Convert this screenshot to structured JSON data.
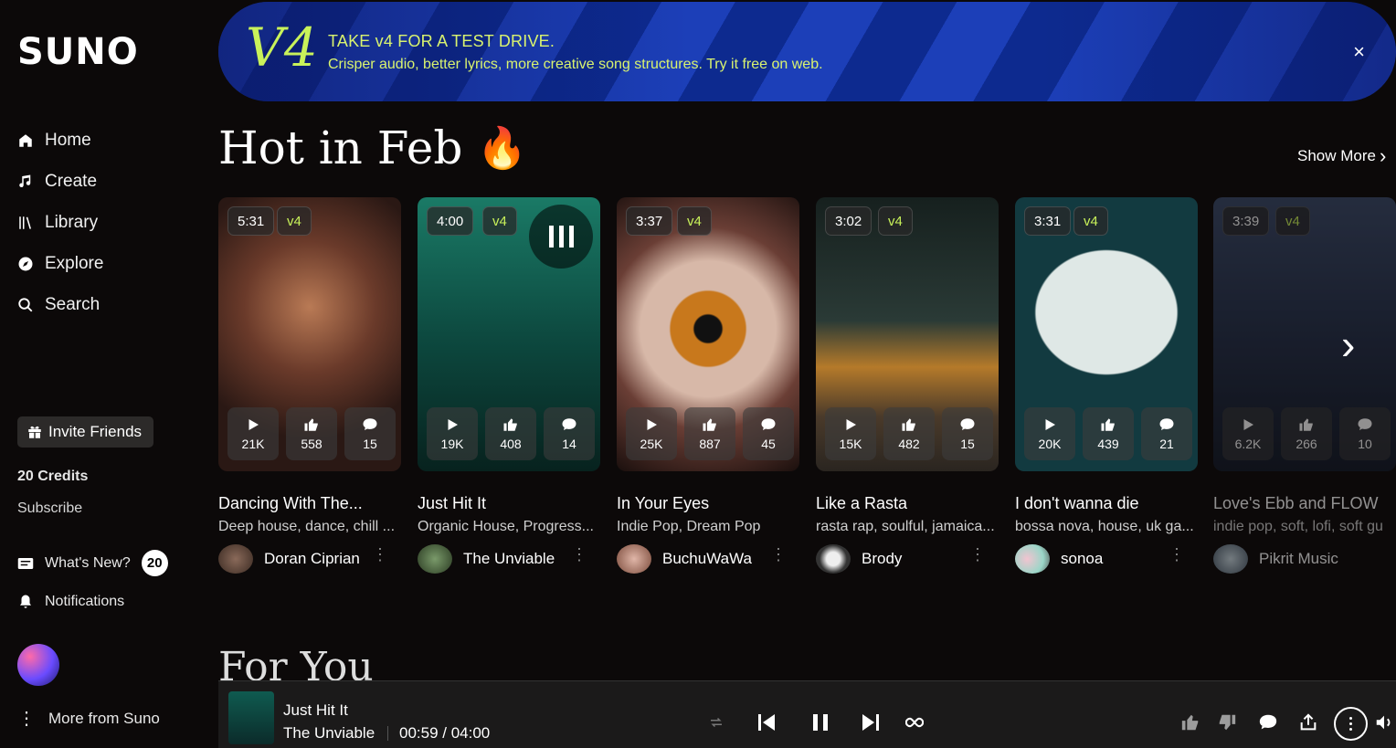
{
  "sidebar": {
    "logo": "SUNO",
    "nav": [
      {
        "label": "Home",
        "icon": "home-icon"
      },
      {
        "label": "Create",
        "icon": "music-note-icon"
      },
      {
        "label": "Library",
        "icon": "library-icon"
      },
      {
        "label": "Explore",
        "icon": "compass-icon"
      },
      {
        "label": "Search",
        "icon": "search-icon"
      }
    ],
    "invite_label": "Invite Friends",
    "credits": "20 Credits",
    "subscribe": "Subscribe",
    "whats_new": "What's New?",
    "whats_new_count": "20",
    "notifications": "Notifications",
    "more": "More from Suno"
  },
  "banner": {
    "logo": "V4",
    "title": "TAKE v4 FOR A TEST DRIVE.",
    "subtitle": "Crisper audio, better lyrics, more creative song structures. Try it free on web.",
    "close": "×"
  },
  "section": {
    "title": "Hot in Feb",
    "show_more": "Show More",
    "next_section": "For You"
  },
  "cards": [
    {
      "duration": "5:31",
      "version": "v4",
      "plays": "21K",
      "likes": "558",
      "comments": "15",
      "title": "Dancing With The...",
      "genre": "Deep house, dance, chill ...",
      "artist": "Doran Ciprian"
    },
    {
      "duration": "4:00",
      "version": "v4",
      "plays": "19K",
      "likes": "408",
      "comments": "14",
      "title": "Just Hit It",
      "genre": "Organic House, Progress...",
      "artist": "The Unviable"
    },
    {
      "duration": "3:37",
      "version": "v4",
      "plays": "25K",
      "likes": "887",
      "comments": "45",
      "title": "In Your Eyes",
      "genre": "Indie Pop, Dream Pop",
      "artist": "BuchuWaWa"
    },
    {
      "duration": "3:02",
      "version": "v4",
      "plays": "15K",
      "likes": "482",
      "comments": "15",
      "title": "Like a Rasta",
      "genre": "rasta rap, soulful, jamaica...",
      "artist": "Brody"
    },
    {
      "duration": "3:31",
      "version": "v4",
      "plays": "20K",
      "likes": "439",
      "comments": "21",
      "title": "I don't wanna die",
      "genre": "bossa nova, house, uk ga...",
      "artist": "sonoa"
    },
    {
      "duration": "3:39",
      "version": "v4",
      "plays": "6.2K",
      "likes": "266",
      "comments": "10",
      "title": "Love's Ebb and FLOW",
      "genre": "indie pop, soft, lofi, soft gu",
      "artist": "Pikrit Music"
    }
  ],
  "player": {
    "title": "Just Hit It",
    "artist": "The Unviable",
    "time": "00:59 / 04:00"
  }
}
